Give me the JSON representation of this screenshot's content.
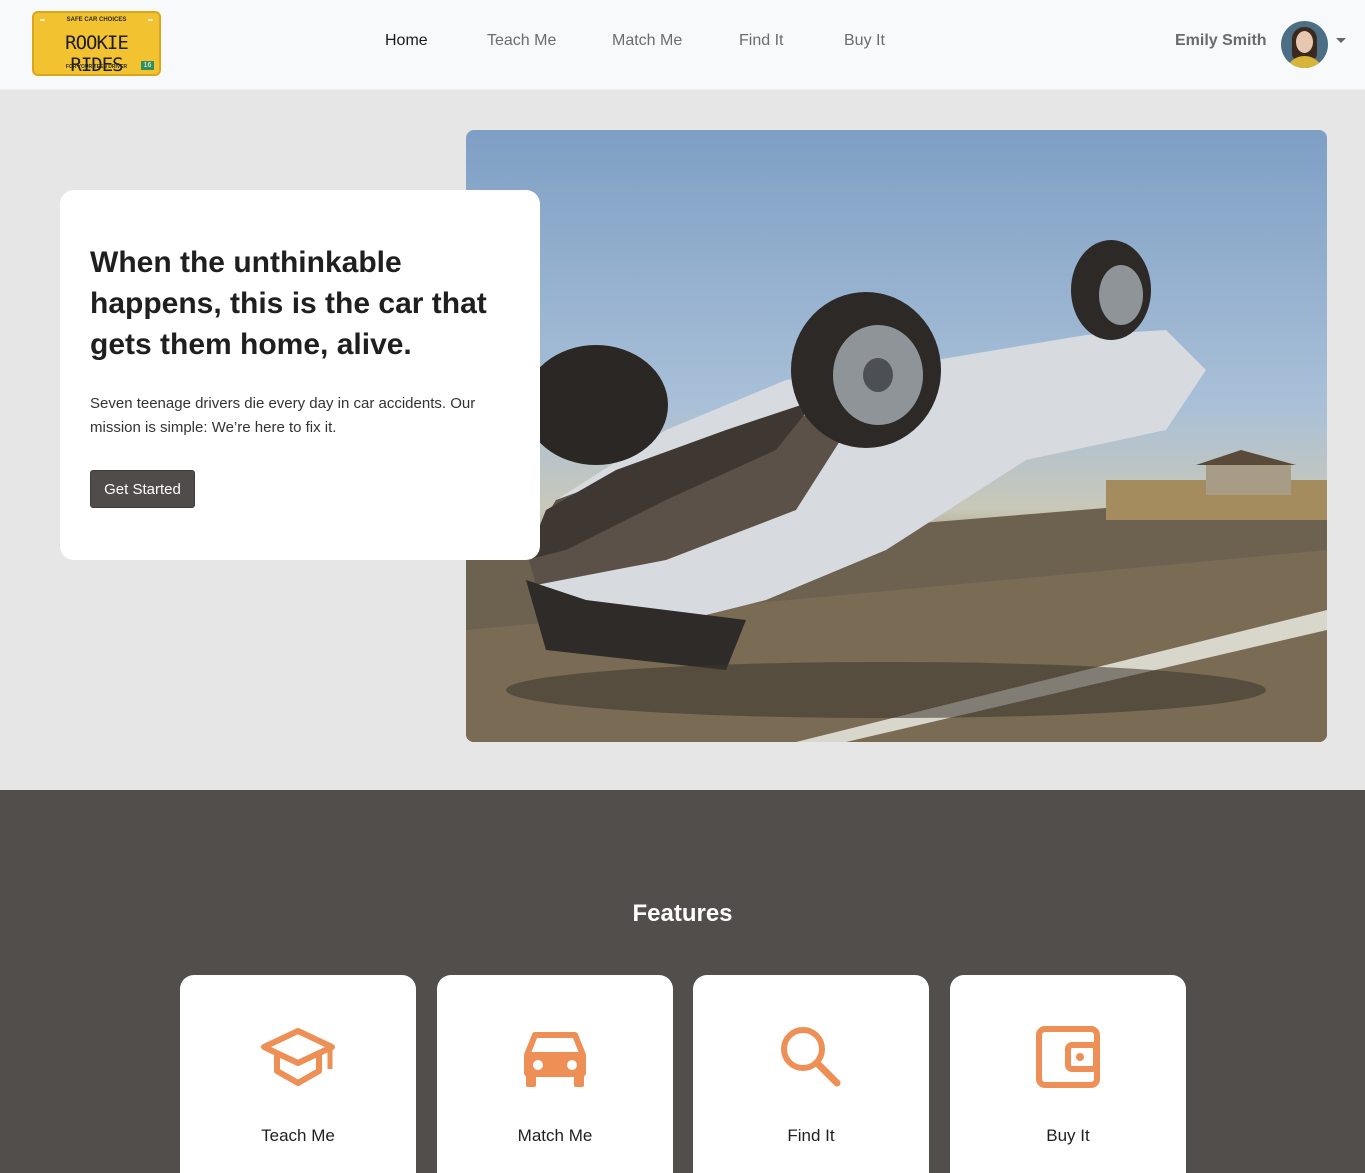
{
  "brand": {
    "tag_top": "SAFE CAR CHOICES",
    "name": "ROOKIE RIDES",
    "tag_bottom": "FOR YOUR TEEN DRIVER",
    "number": "16",
    "color": "#f2c230"
  },
  "nav": {
    "items": [
      {
        "label": "Home",
        "active": true
      },
      {
        "label": "Teach Me",
        "active": false
      },
      {
        "label": "Match Me",
        "active": false
      },
      {
        "label": "Find It",
        "active": false
      },
      {
        "label": "Buy It",
        "active": false
      }
    ]
  },
  "user": {
    "name": "Emily Smith",
    "avatar_icon": "user-avatar",
    "menu_icon": "caret-down-icon"
  },
  "hero": {
    "title": "When the unthinkable happens, this is the car that gets them home, alive.",
    "text": "Seven teenage drivers die every day in car accidents. Our mission is simple: We’re here to fix it.",
    "button": "Get Started"
  },
  "features": {
    "title": "Features",
    "accent": "#ee8f55",
    "items": [
      {
        "label": "Teach Me",
        "icon": "graduation-cap-icon"
      },
      {
        "label": "Match Me",
        "icon": "car-icon"
      },
      {
        "label": "Find It",
        "icon": "search-icon"
      },
      {
        "label": "Buy It",
        "icon": "wallet-icon"
      }
    ]
  }
}
